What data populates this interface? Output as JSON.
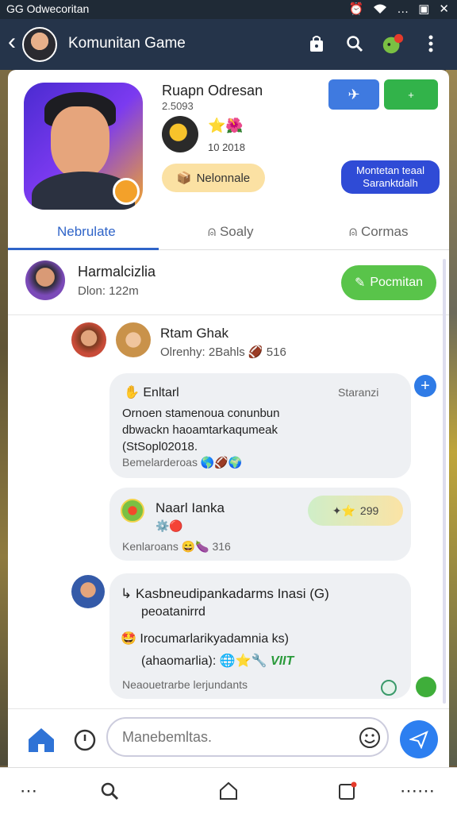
{
  "status_bar": {
    "title": "GG Odwecoritan",
    "icons": [
      "alarm-icon",
      "wifi-icon",
      "dots-icon",
      "image-icon",
      "close-icon"
    ]
  },
  "app_bar": {
    "title": "Komunitan Game",
    "back_icon": "back-arrow-icon"
  },
  "game": {
    "name": "Ruapn Odresan",
    "subtitle": "2.5093",
    "date": "10 2018",
    "tag_label": "Nelonnale",
    "action_label": "Montetan teaal Saranktdalh",
    "right_button": "+"
  },
  "tabs": [
    {
      "label": "Nebrulate"
    },
    {
      "label": "Soaly"
    },
    {
      "label": "Cormas"
    }
  ],
  "author": {
    "name": "Harmalcizlia",
    "meta": "Dlon: 122m",
    "follow_label": "Pocmitan"
  },
  "sub_author": {
    "name": "Rtam Ghak",
    "meta": "Olrenhy: 2Bahls",
    "count": "516"
  },
  "posts": [
    {
      "title": "Enltarl",
      "tag": "Staranzi",
      "body": "Ornoen stamenoua conunbun dbwackn haoamtarkaqumeak (StSopl02018.",
      "footer": "Bemelarderoas"
    },
    {
      "title": "Naarl Ianka",
      "score": "299",
      "footer": "Kenlaroans",
      "count": "316"
    },
    {
      "title": "Kasbneudipankadarms Inasi (G)",
      "subtitle": "peoatanirrd",
      "line2": "Irocumarlarikyadamnia ks)",
      "line3": "(ahaomarlia):",
      "tag": "VIIT",
      "footer": "Neaouetrarbe lerjundants"
    }
  ],
  "composer": {
    "placeholder": "Manebemltas."
  },
  "colors": {
    "primary": "#2f64c8",
    "green": "#59c44a",
    "navy": "#25344a"
  }
}
